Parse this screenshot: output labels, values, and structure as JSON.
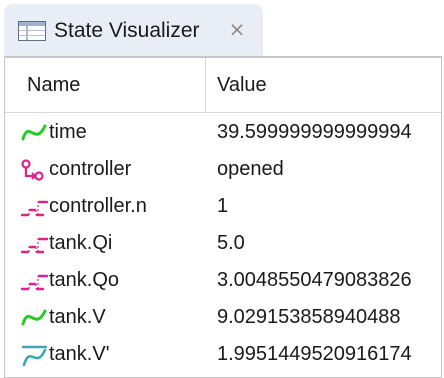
{
  "tab": {
    "title": "State Visualizer",
    "close_glyph": "⨯",
    "icon": "state-visualizer-view-icon"
  },
  "columns": {
    "name": "Name",
    "value": "Value"
  },
  "rows": [
    {
      "name": "time",
      "value": "39.599999999999994",
      "icon": "continuous-variable-icon"
    },
    {
      "name": "controller",
      "value": "opened",
      "icon": "automaton-icon"
    },
    {
      "name": "controller.n",
      "value": "1",
      "icon": "discrete-variable-icon"
    },
    {
      "name": "tank.Qi",
      "value": "5.0",
      "icon": "discrete-variable-icon"
    },
    {
      "name": "tank.Qo",
      "value": "3.0048550479083826",
      "icon": "discrete-variable-icon"
    },
    {
      "name": "tank.V",
      "value": "9.029153858940488",
      "icon": "continuous-variable-icon"
    },
    {
      "name": "tank.V'",
      "value": "1.9951449520916174",
      "icon": "derivative-variable-icon"
    }
  ],
  "colors": {
    "continuous": "#22cc22",
    "discrete": "#e0218a",
    "derivative": "#3aa8b4",
    "tab_bg": "#e9eef6"
  }
}
